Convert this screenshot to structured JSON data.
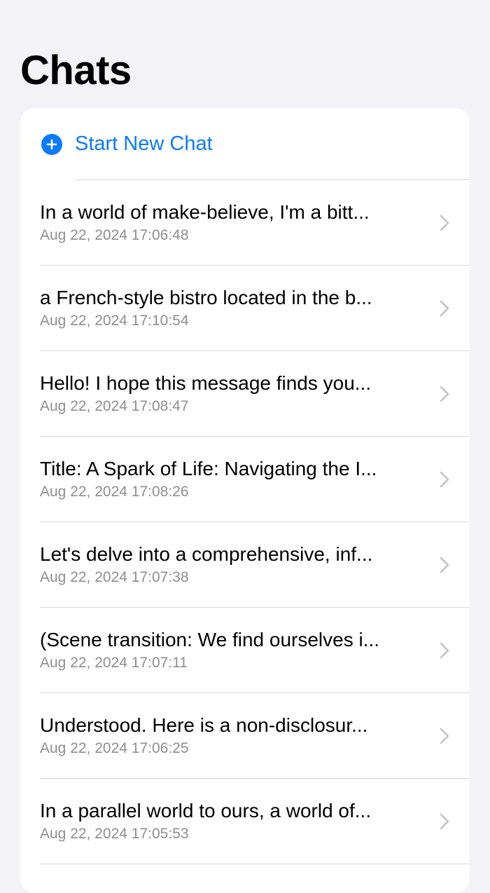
{
  "header": {
    "title": "Chats"
  },
  "new_chat": {
    "label": "Start New Chat"
  },
  "colors": {
    "accent": "#0a7aff",
    "secondary_text": "#8e8e93",
    "background": "#f2f2f7"
  },
  "chats": [
    {
      "title": "In a world of make-believe, I'm a bitt...",
      "time": "Aug 22, 2024 17:06:48"
    },
    {
      "title": "a French-style bistro located in the b...",
      "time": "Aug 22, 2024 17:10:54"
    },
    {
      "title": "Hello! I hope this message finds you...",
      "time": "Aug 22, 2024 17:08:47"
    },
    {
      "title": "Title: A Spark of Life: Navigating the I...",
      "time": "Aug 22, 2024 17:08:26"
    },
    {
      "title": "Let's delve into a comprehensive, inf...",
      "time": "Aug 22, 2024 17:07:38"
    },
    {
      "title": "(Scene transition: We find ourselves i...",
      "time": "Aug 22, 2024 17:07:11"
    },
    {
      "title": "Understood. Here is a non-disclosur...",
      "time": "Aug 22, 2024 17:06:25"
    },
    {
      "title": "In a parallel world to ours, a world of...",
      "time": "Aug 22, 2024 17:05:53"
    }
  ]
}
